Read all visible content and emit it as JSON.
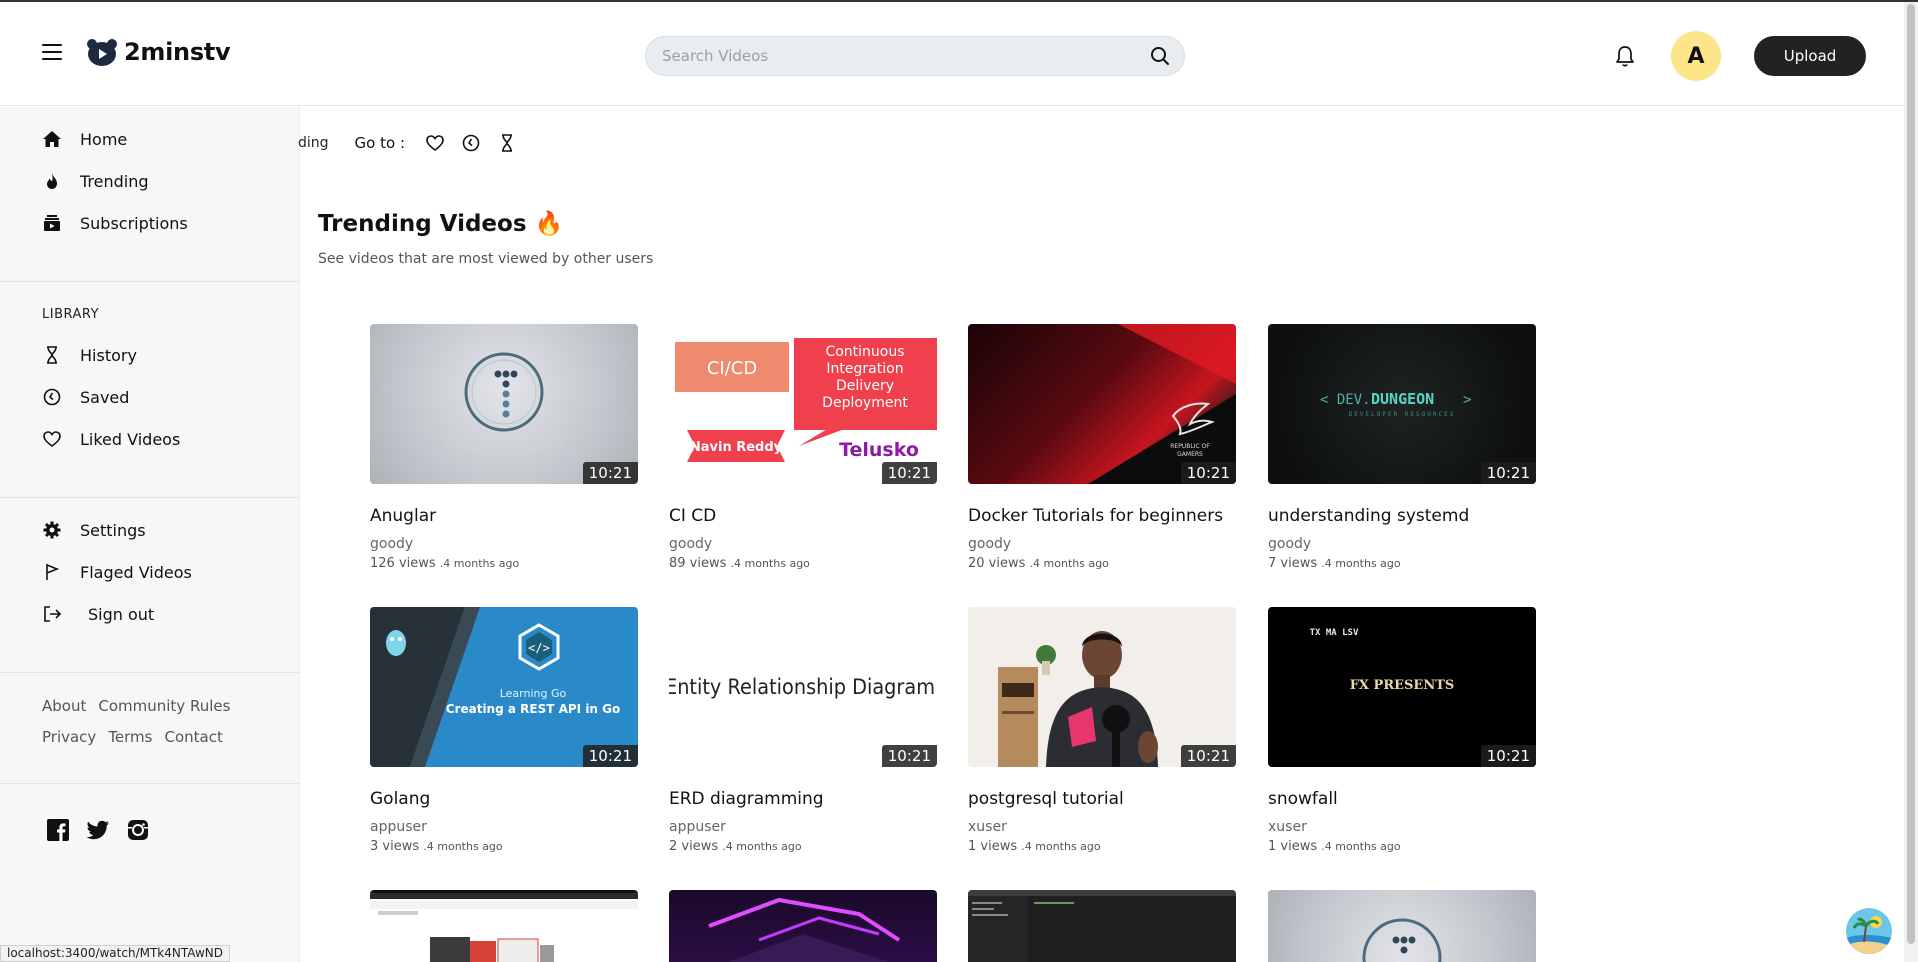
{
  "app": {
    "name": "2minstv"
  },
  "header": {
    "search_placeholder": "Search Videos",
    "avatar_letter": "A",
    "upload_label": "Upload"
  },
  "sidebar": {
    "main": [
      {
        "label": "Home",
        "icon": "home-icon"
      },
      {
        "label": "Trending",
        "icon": "flame-icon"
      },
      {
        "label": "Subscriptions",
        "icon": "subscriptions-icon"
      }
    ],
    "library_label": "LIBRARY",
    "library": [
      {
        "label": "History",
        "icon": "hourglass-icon"
      },
      {
        "label": "Saved",
        "icon": "clock-icon"
      },
      {
        "label": "Liked Videos",
        "icon": "heart-icon"
      }
    ],
    "account": [
      {
        "label": "Settings",
        "icon": "gear-icon"
      },
      {
        "label": "Flaged Videos",
        "icon": "flag-icon"
      },
      {
        "label": "Sign out",
        "icon": "sign-out-icon"
      }
    ],
    "footer_row1": [
      "About",
      "Community Rules"
    ],
    "footer_row2": [
      "Privacy",
      "Terms",
      "Contact"
    ],
    "socials": [
      "facebook-icon",
      "twitter-icon",
      "instagram-icon"
    ]
  },
  "goto": {
    "cut_text": "ding",
    "label": "Go to :",
    "icons": [
      "heart-icon",
      "clock-icon",
      "hourglass-icon"
    ]
  },
  "page": {
    "title": "Trending Videos 🔥",
    "subtitle": "See videos that are most viewed by other users"
  },
  "videos": [
    {
      "title": "Anuglar",
      "author": "goody",
      "views": "126 views",
      "age": ".4 months ago",
      "duration": "10:21"
    },
    {
      "title": "CI CD",
      "author": "goody",
      "views": "89 views",
      "age": ".4 months ago",
      "duration": "10:21"
    },
    {
      "title": "Docker Tutorials for beginners",
      "author": "goody",
      "views": "20 views",
      "age": ".4 months ago",
      "duration": "10:21"
    },
    {
      "title": "understanding systemd",
      "author": "goody",
      "views": "7 views",
      "age": ".4 months ago",
      "duration": "10:21"
    },
    {
      "title": "Golang",
      "author": "appuser",
      "views": "3 views",
      "age": ".4 months ago",
      "duration": "10:21"
    },
    {
      "title": "ERD diagramming",
      "author": "appuser",
      "views": "2 views",
      "age": ".4 months ago",
      "duration": "10:21"
    },
    {
      "title": "postgresql tutorial",
      "author": "xuser",
      "views": "1 views",
      "age": ".4 months ago",
      "duration": "10:21"
    },
    {
      "title": "snowfall",
      "author": "xuser",
      "views": "1 views",
      "age": ".4 months ago",
      "duration": "10:21"
    }
  ],
  "thumb_text": {
    "cicd_left": "CI/CD",
    "cicd_right": [
      "Continuous",
      "Integration",
      "Delivery",
      "Deployment"
    ],
    "cicd_name": "Navin Reddy",
    "cicd_brand": "Telusko",
    "rog": [
      "REPUBLIC OF",
      "GAMERS"
    ],
    "dungeon_left": "< DEV.",
    "dungeon_main": "DUNGEON",
    "dungeon_right": " >",
    "dungeon_sub": "DEVELOPER RESOURCES",
    "go_line1": "Learning Go",
    "go_line2": "Creating a REST API in Go",
    "erd": "Entity Relationship Diagram",
    "fx": "FX PRESENTS",
    "fx_logo": "TX MA LSV"
  },
  "status_url": "localhost:3400/watch/MTk4NTAwND"
}
